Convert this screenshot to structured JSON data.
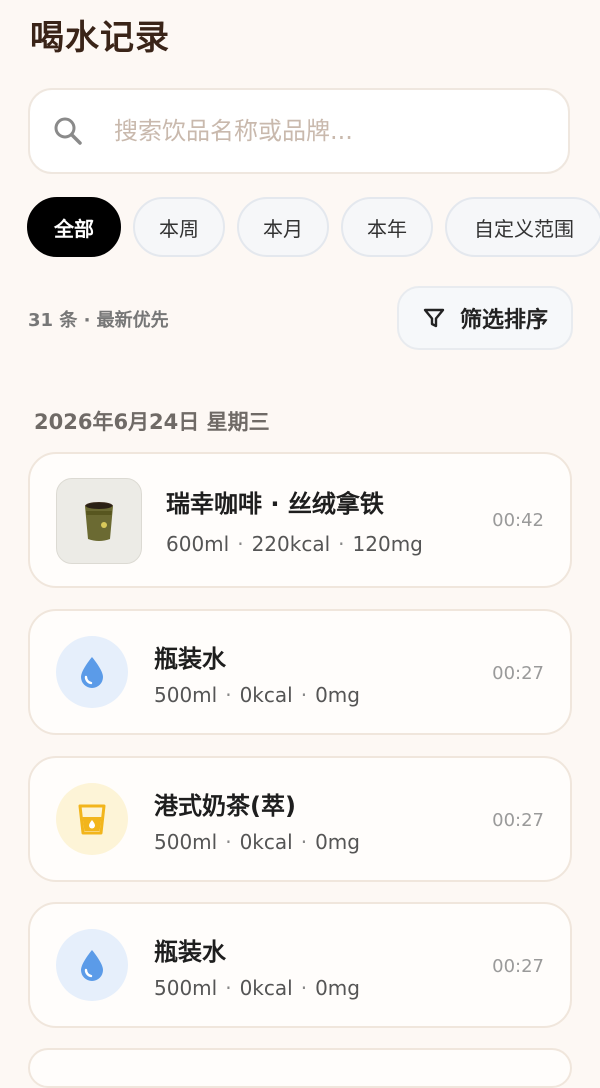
{
  "header": {
    "title": "喝水记录"
  },
  "search": {
    "placeholder": "搜索饮品名称或品牌..."
  },
  "filters": {
    "chips": [
      {
        "label": "全部",
        "active": true
      },
      {
        "label": "本周",
        "active": false
      },
      {
        "label": "本月",
        "active": false
      },
      {
        "label": "本年",
        "active": false
      },
      {
        "label": "自定义范围",
        "active": false
      }
    ]
  },
  "summary": {
    "count_text": "31 条 · 最新优先",
    "filter_button_label": "筛选排序"
  },
  "groups": [
    {
      "date": "2026年6月24日 星期三",
      "entries": [
        {
          "name": "瑞幸咖啡 · 丝绒拿铁",
          "volume": "600ml",
          "calories": "220kcal",
          "caffeine": "120mg",
          "time": "00:42",
          "icon": "coffee-cup-photo"
        },
        {
          "name": "瓶装水",
          "volume": "500ml",
          "calories": "0kcal",
          "caffeine": "0mg",
          "time": "00:27",
          "icon": "water-drop-icon"
        },
        {
          "name": "港式奶茶(萃)",
          "volume": "500ml",
          "calories": "0kcal",
          "caffeine": "0mg",
          "time": "00:27",
          "icon": "milk-tea-cup-icon"
        },
        {
          "name": "瓶装水",
          "volume": "500ml",
          "calories": "0kcal",
          "caffeine": "0mg",
          "time": "00:27",
          "icon": "water-drop-icon"
        }
      ]
    }
  ],
  "colors": {
    "background": "#fdf8f4",
    "title": "#3a2418",
    "active_chip": "#000000",
    "water_icon": "#5b9be8",
    "tea_icon": "#f2b51c"
  }
}
